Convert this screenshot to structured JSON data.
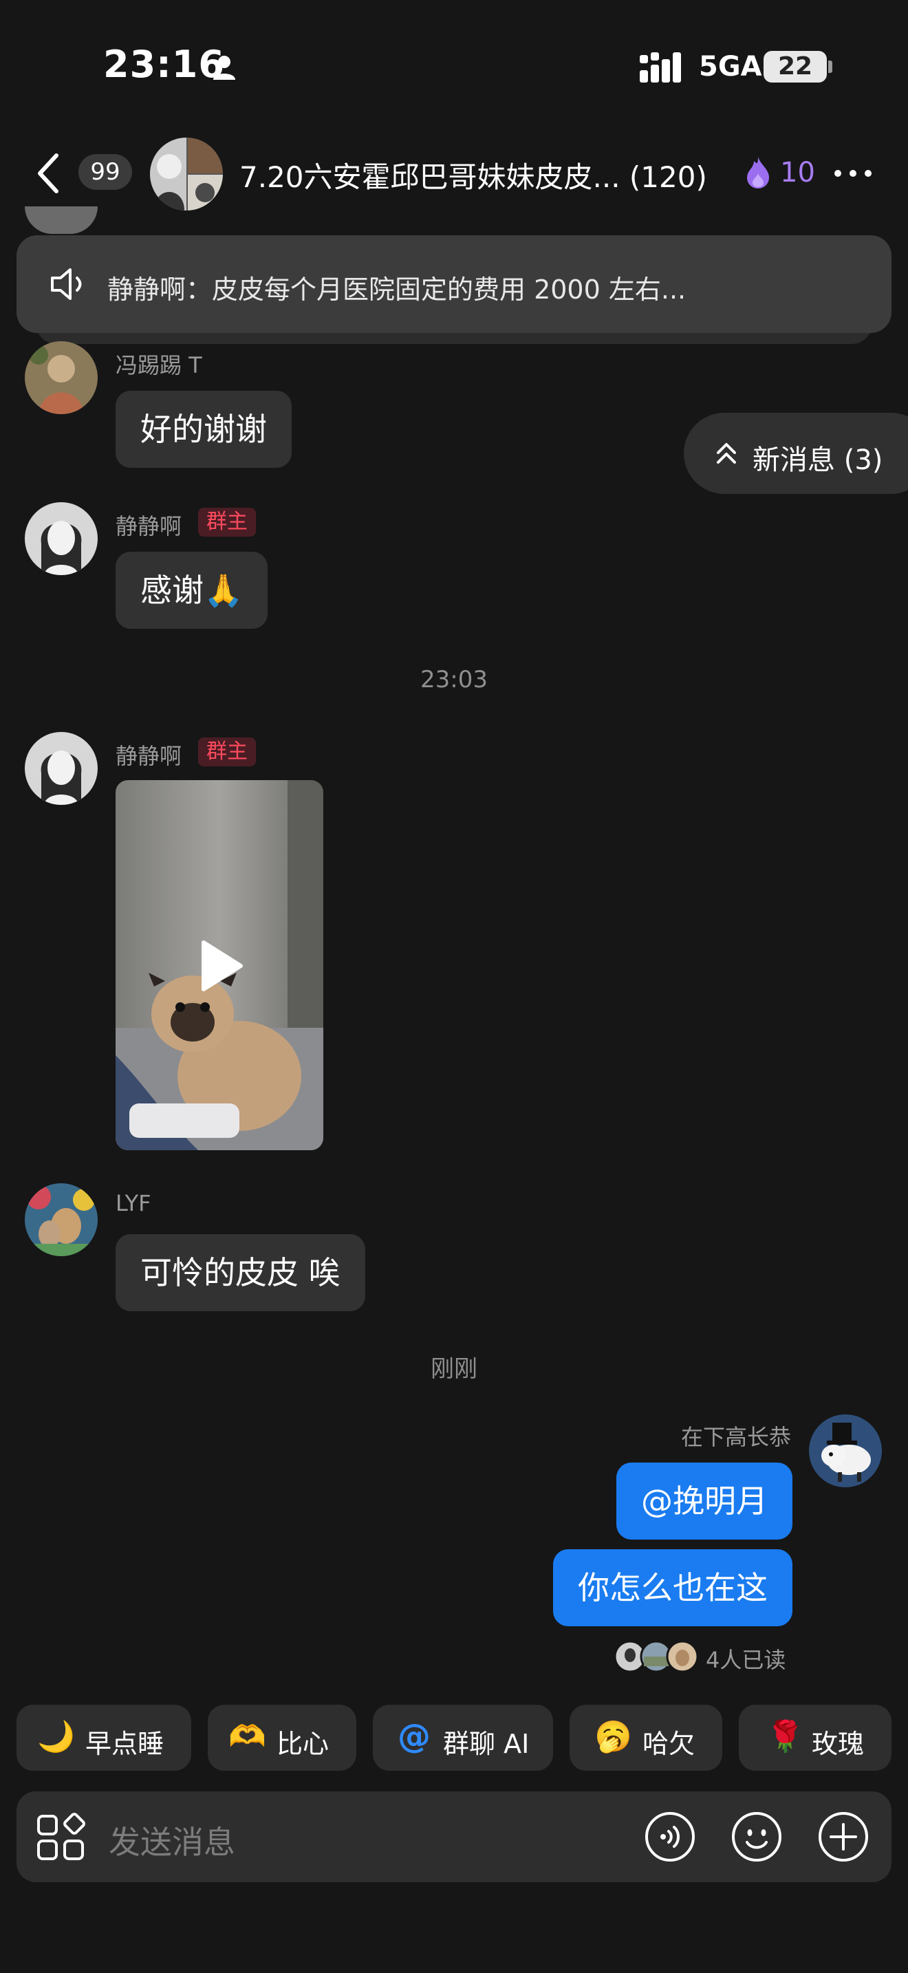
{
  "status_bar": {
    "time": "23:16",
    "network": "5GA",
    "battery": "22"
  },
  "header": {
    "unread_count": "99",
    "title": "7.20六安霍邱巴哥妹妹皮皮... (120)",
    "fire_count": "10"
  },
  "announcement": {
    "text": "静静啊：皮皮每个月医院固定的费用 2000 左右..."
  },
  "new_messages": {
    "label": "新消息 (3)"
  },
  "messages": [
    {
      "sender": "冯踢踢 T",
      "text": "好的谢谢"
    },
    {
      "sender": "静静啊",
      "badge": "群主",
      "text": "感谢🙏"
    },
    {
      "sender": "静静啊",
      "badge": "群主"
    },
    {
      "sender": "LYF",
      "text": "可怜的皮皮 唉"
    }
  ],
  "timestamps": {
    "first": "23:03",
    "second": "刚刚"
  },
  "my_messages": {
    "sender": "在下高长恭",
    "items": [
      "@挽明月",
      "你怎么也在这"
    ],
    "read_receipt": "4人已读"
  },
  "quick_actions": [
    {
      "emoji": "🌙",
      "label": "早点睡"
    },
    {
      "emoji": "🫶",
      "label": "比心"
    },
    {
      "emoji": "@",
      "label": "群聊 AI"
    },
    {
      "emoji": "🥱",
      "label": "哈欠"
    },
    {
      "emoji": "🌹",
      "label": "玫瑰"
    }
  ],
  "input": {
    "placeholder": "发送消息"
  },
  "colors": {
    "accent_blue": "#1a7cf0",
    "owner_red": "#ff4a5e",
    "fire_purple": "#a77cf2"
  }
}
